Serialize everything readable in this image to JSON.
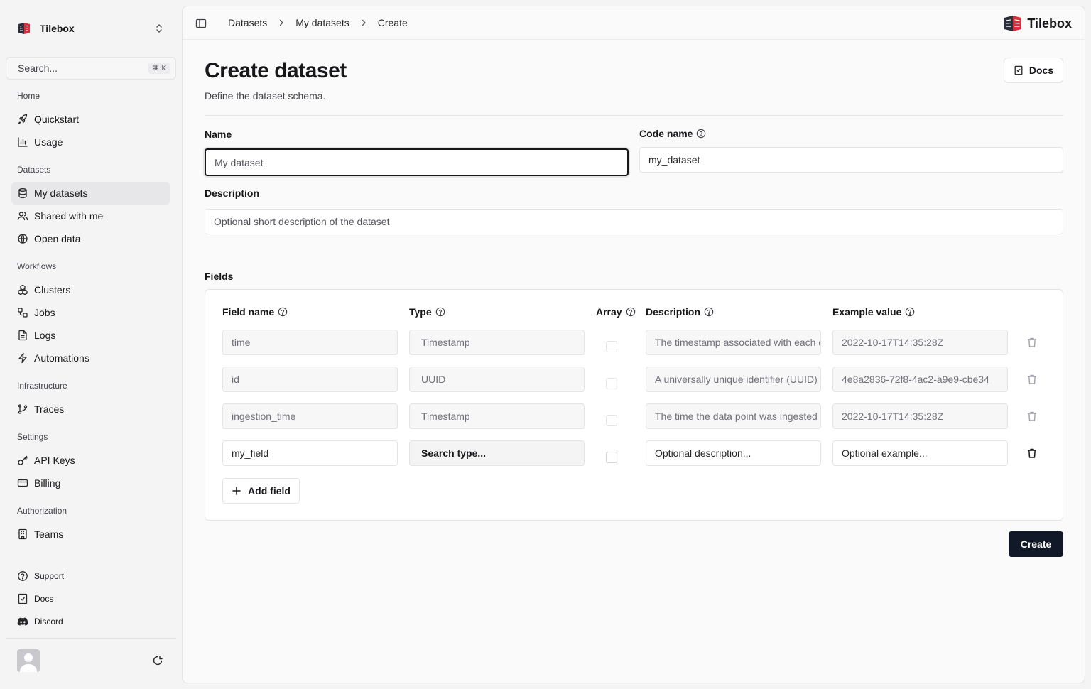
{
  "sidebar": {
    "workspace_name": "Tilebox",
    "search": {
      "placeholder": "Search...",
      "shortcut": "⌘ K"
    },
    "groups": {
      "home": "Home",
      "datasets": "Datasets",
      "workflows": "Workflows",
      "infrastructure": "Infrastructure",
      "settings": "Settings",
      "authorization": "Authorization"
    },
    "items": {
      "quickstart": "Quickstart",
      "usage": "Usage",
      "my_datasets": "My datasets",
      "shared_with_me": "Shared with me",
      "open_data": "Open data",
      "clusters": "Clusters",
      "jobs": "Jobs",
      "logs": "Logs",
      "automations": "Automations",
      "traces": "Traces",
      "api_keys": "API Keys",
      "billing": "Billing",
      "teams": "Teams",
      "support": "Support",
      "docs": "Docs",
      "discord": "Discord"
    },
    "active_item": "My datasets"
  },
  "header": {
    "breadcrumbs": [
      "Datasets",
      "My datasets",
      "Create"
    ],
    "brand": "Tilebox"
  },
  "page": {
    "title": "Create dataset",
    "subtitle": "Define the dataset schema.",
    "docs_button": "Docs"
  },
  "form": {
    "name_label": "Name",
    "name_placeholder": "My dataset",
    "code_name_label": "Code name",
    "code_name_value": "my_dataset",
    "description_label": "Description",
    "description_placeholder": "Optional short description of the dataset",
    "fields_label": "Fields"
  },
  "fields_table": {
    "headers": {
      "field_name": "Field name",
      "type": "Type",
      "array": "Array",
      "description": "Description",
      "example": "Example value"
    },
    "rows": [
      {
        "name": "time",
        "type": "Timestamp",
        "array": false,
        "description": "The timestamp associated with each data point",
        "example": "2022-10-17T14:35:28Z",
        "readonly": true
      },
      {
        "name": "id",
        "type": "UUID",
        "array": false,
        "description": "A universally unique identifier (UUID) for each data point",
        "example": "4e8a2836-72f8-4ac2-a9e9-cbe34",
        "readonly": true
      },
      {
        "name": "ingestion_time",
        "type": "Timestamp",
        "array": false,
        "description": "The time the data point was ingested into the system",
        "example": "2022-10-17T14:35:28Z",
        "readonly": true
      },
      {
        "name": "my_field",
        "type": "Search type...",
        "array": false,
        "description": "Optional description...",
        "example": "Optional example...",
        "readonly": false
      }
    ],
    "add_field_button": "Add field"
  },
  "create_button": "Create",
  "icons": {
    "workspace": "tilebox-logo-icon",
    "switcher": "chevrons-up-down-icon",
    "sidebar_toggle": "panel-left-icon",
    "breadcrumb_separator": "chevron-right-icon",
    "help": "help-circle-icon",
    "delete": "trash-icon",
    "add": "plus-icon",
    "theme": "theme-toggle-icon"
  },
  "colors": {
    "primary_button": "#111827",
    "brand_red": "#dc2d3c",
    "brand_dark": "#2b2f3b"
  }
}
